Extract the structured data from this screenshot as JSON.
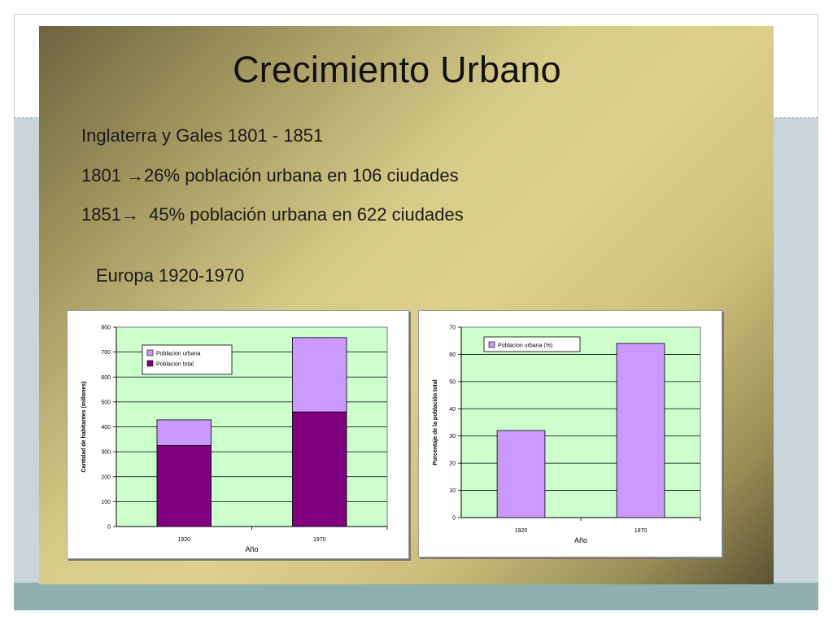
{
  "slide": {
    "title": "Crecimiento Urbano",
    "lines": [
      "Inglaterra y Gales 1801 - 1851",
      "1801 →26% población urbana en 106 ciudades",
      "1851→  45% población urbana en 622 ciudades"
    ],
    "subheading": "Europa 1920-1970"
  },
  "colors": {
    "plot_bg": "#ccffcc",
    "urban_bar": "#cc99ff",
    "total_bar": "#800080"
  },
  "chart_data": [
    {
      "type": "bar",
      "stacked": true,
      "categories": [
        "1920",
        "1970"
      ],
      "series": [
        {
          "name": "Poblacion total",
          "values": [
            325,
            460
          ]
        },
        {
          "name": "Poblacion urbana",
          "values": [
            103,
            298
          ]
        }
      ],
      "ylabel": "Cantidad de habitantes (millones)",
      "xlabel": "Año",
      "ylim": [
        0,
        800
      ],
      "yticks": [
        "0",
        "100",
        "200",
        "300",
        "400",
        "500",
        "600",
        "700",
        "800"
      ],
      "grid": true,
      "legend": "top-left"
    },
    {
      "type": "bar",
      "categories": [
        "1920",
        "1970"
      ],
      "series": [
        {
          "name": "Poblacion urbana (%)",
          "values": [
            32,
            64
          ]
        }
      ],
      "ylabel": "Porcentaje de la población total",
      "xlabel": "Año",
      "ylim": [
        0,
        70
      ],
      "yticks": [
        "0",
        "10",
        "20",
        "30",
        "40",
        "50",
        "60",
        "70"
      ],
      "grid": true,
      "legend": "top-left"
    }
  ]
}
